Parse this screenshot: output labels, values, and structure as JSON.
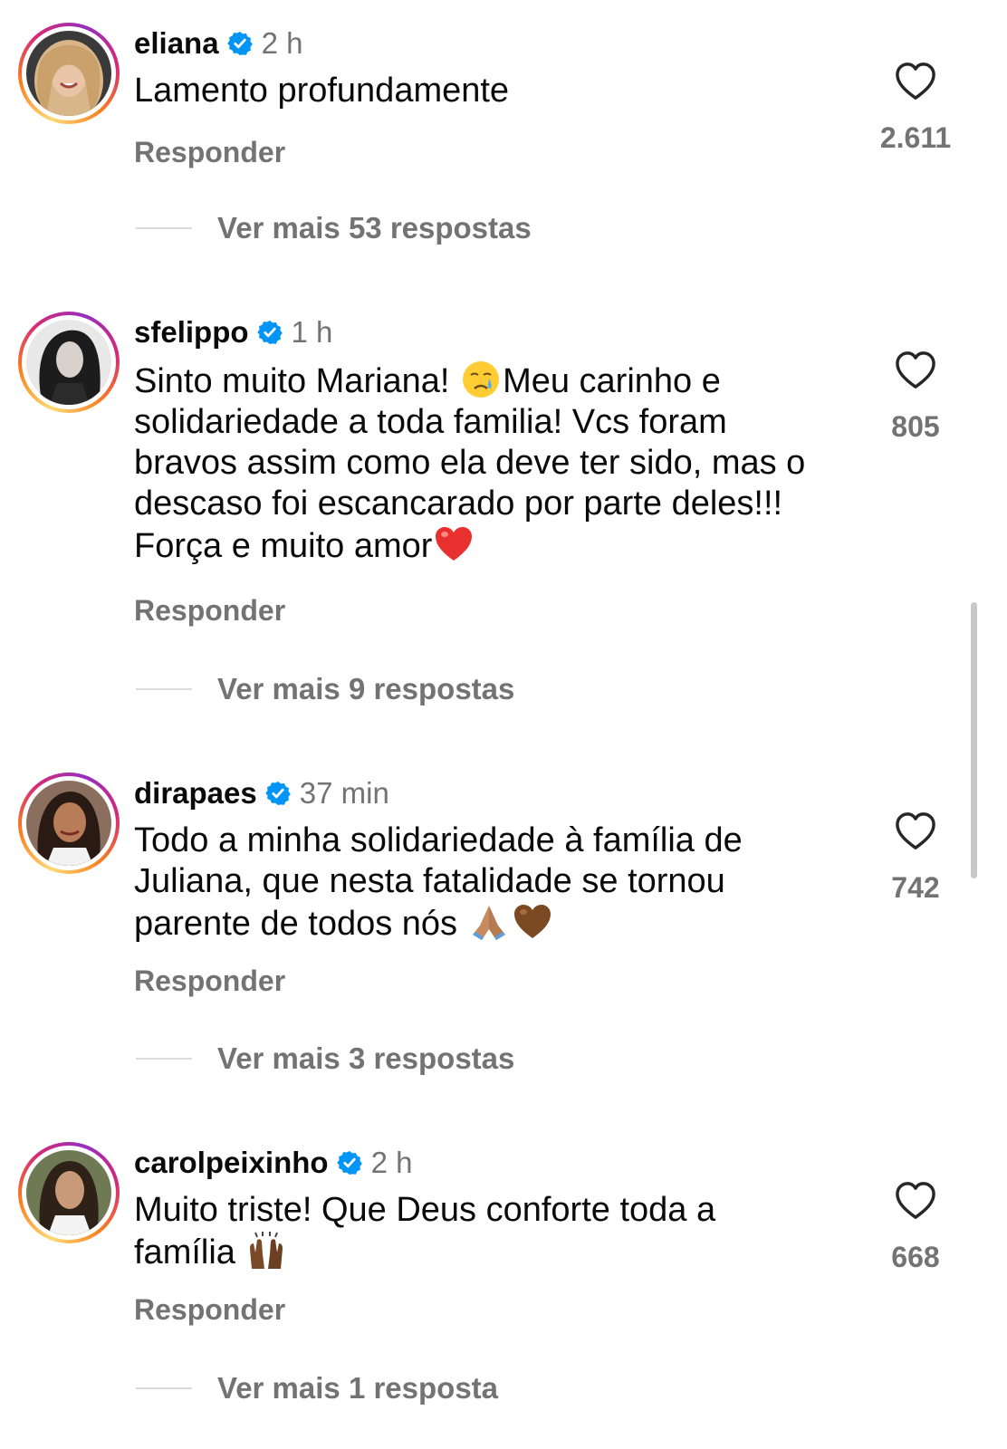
{
  "comments": [
    {
      "username": "eliana",
      "verified": true,
      "time": "2 h",
      "text": "Lamento profundamente",
      "reply_label": "Responder",
      "likes": "2.611",
      "more_replies": "Ver mais 53 respostas"
    },
    {
      "username": "sfelippo",
      "verified": true,
      "time": "1 h",
      "text_parts": [
        "Sinto muito Mariana! ",
        "Meu carinho e\nsolidariedade a toda familia! Vcs foram\nbravos assim como ela deve ter sido, mas o\ndescaso foi escancarado por parte deles!!!\nForça e muito amor"
      ],
      "emojis": [
        "crying-face",
        "red-heart"
      ],
      "reply_label": "Responder",
      "likes": "805",
      "more_replies": "Ver mais 9 respostas"
    },
    {
      "username": "dirapaes",
      "verified": true,
      "time": "37 min",
      "text_parts": [
        "Todo a minha solidariedade à família de\nJuliana, que nesta fatalidade se tornou\nparente de todos nós "
      ],
      "emojis": [
        "folded-hands",
        "brown-heart"
      ],
      "reply_label": "Responder",
      "likes": "742",
      "more_replies": "Ver mais 3 respostas"
    },
    {
      "username": "carolpeixinho",
      "verified": true,
      "time": "2 h",
      "text_parts": [
        "Muito triste! Que Deus conforte toda a\nfamília "
      ],
      "emojis": [
        "raising-hands"
      ],
      "reply_label": "Responder",
      "likes": "668",
      "more_replies": "Ver mais 1 resposta"
    }
  ],
  "icons": {
    "verified": "verified-badge-icon",
    "like": "heart-outline-icon"
  },
  "colors": {
    "verified_blue": "#0095f6",
    "secondary_text": "#737373",
    "primary_text": "#0a0a0a"
  }
}
